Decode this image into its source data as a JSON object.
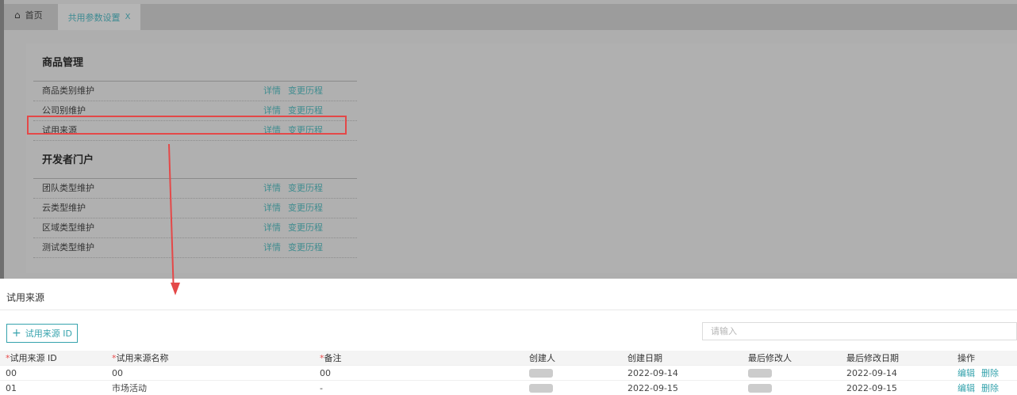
{
  "tabs": {
    "home_label": "首页",
    "active_label": "共用参数设置",
    "close_glyph": "X"
  },
  "sections": [
    {
      "title": "商品管理",
      "rows": [
        {
          "label": "商品类别维护",
          "detail": "详情",
          "history": "变更历程"
        },
        {
          "label": "公司别维护",
          "detail": "详情",
          "history": "变更历程"
        },
        {
          "label": "试用来源",
          "detail": "详情",
          "history": "变更历程",
          "highlighted": true
        }
      ]
    },
    {
      "title": "开发者门户",
      "rows": [
        {
          "label": "团队类型维护",
          "detail": "详情",
          "history": "变更历程"
        },
        {
          "label": "云类型维护",
          "detail": "详情",
          "history": "变更历程"
        },
        {
          "label": "区域类型维护",
          "detail": "详情",
          "history": "变更历程"
        },
        {
          "label": "测试类型维护",
          "detail": "详情",
          "history": "变更历程"
        }
      ]
    }
  ],
  "panel": {
    "title": "试用来源",
    "add_button": "试用来源 ID",
    "search_placeholder": "请输入",
    "columns": {
      "id": "试用来源 ID",
      "name": "试用来源名称",
      "remark": "备注",
      "creator": "创建人",
      "created": "创建日期",
      "modifier": "最后修改人",
      "modified": "最后修改日期",
      "ops": "操作"
    },
    "rows": [
      {
        "id": "00",
        "name": "00",
        "remark": "00",
        "created": "2022-09-14",
        "modified": "2022-09-14",
        "edit": "编辑",
        "del": "删除"
      },
      {
        "id": "01",
        "name": "市场活动",
        "remark": "-",
        "created": "2022-09-15",
        "modified": "2022-09-15",
        "edit": "编辑",
        "del": "删除"
      }
    ]
  },
  "colors": {
    "accent": "#36a3ad",
    "highlight": "#e44848",
    "required": "#e84d4d"
  },
  "icons": {
    "home": "home-icon",
    "close": "close-icon",
    "add": "plus-icon"
  }
}
